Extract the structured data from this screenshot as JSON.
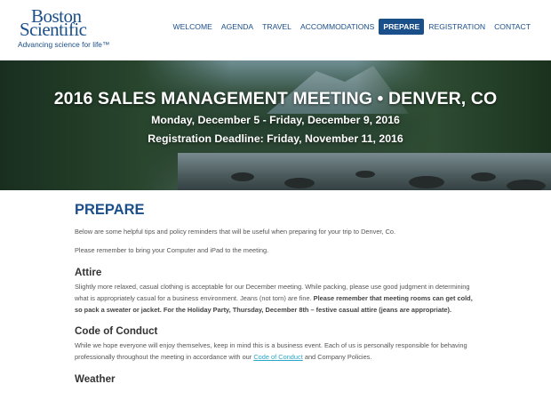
{
  "brand": {
    "name_line1": "Boston",
    "name_line2": "Scientific",
    "tagline": "Advancing science for life™"
  },
  "nav": {
    "items": [
      "WELCOME",
      "AGENDA",
      "TRAVEL",
      "ACCOMMODATIONS",
      "PREPARE",
      "REGISTRATION",
      "CONTACT"
    ],
    "active": "PREPARE"
  },
  "hero": {
    "title": "2016 SALES MANAGEMENT MEETING • DENVER, CO",
    "dates": "Monday, December 5 - Friday, December 9, 2016",
    "deadline": "Registration Deadline: Friday, November 11, 2016"
  },
  "main": {
    "title": "PREPARE",
    "intro": "Below are some helpful tips and policy reminders that will be useful when preparing for your trip to Denver, Co.",
    "intro2": "Please remember to bring your Computer and iPad to the meeting.",
    "attire": {
      "heading": "Attire",
      "text_plain": "Slightly more relaxed, casual clothing is acceptable for our December meeting. While packing, please use good judgment in determining what is appropriately casual for a business environment. Jeans (not torn) are fine. ",
      "text_bold": "Please remember that meeting rooms can get cold, so pack a sweater or jacket. For the Holiday Party, Thursday, December 8th – festive casual attire (jeans are appropriate)."
    },
    "conduct": {
      "heading": "Code of Conduct",
      "text_before": "While we hope everyone will enjoy themselves, keep in mind this is a business event. Each of us is personally responsible for behaving professionally throughout the meeting in accordance with our ",
      "link": "Code of Conduct",
      "text_after": " and Company Policies."
    },
    "weather": {
      "heading": "Weather"
    }
  },
  "colors": {
    "brand_blue": "#1b4f8a",
    "link": "#2aa6c7"
  }
}
